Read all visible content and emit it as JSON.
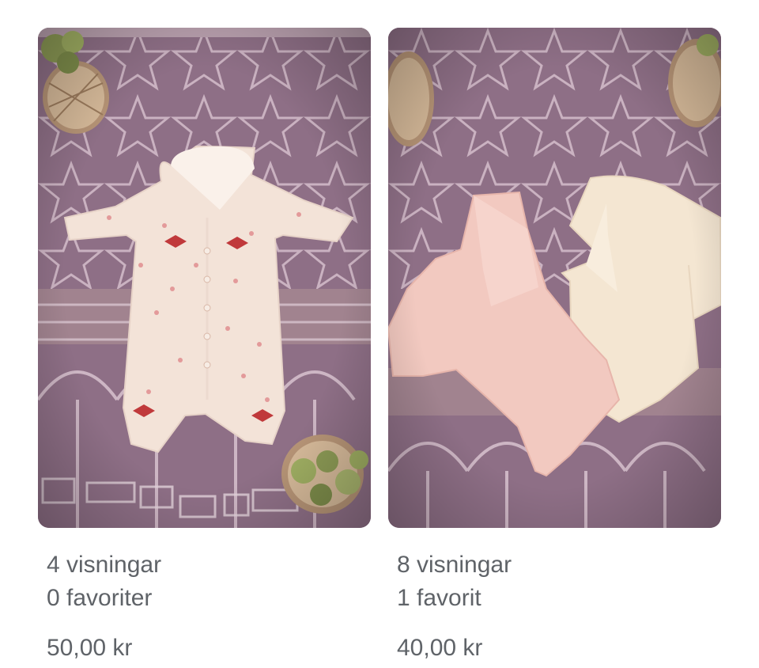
{
  "listings": [
    {
      "views": "4 visningar",
      "favorites": "0 favoriter",
      "price": "50,00 kr",
      "image_icon": "baby-romper-photo",
      "colors": {
        "rug": "#8e6f86",
        "pattern": "#d9c3cf",
        "garment": "#f3e3d8",
        "accent": "#c0393b"
      }
    },
    {
      "views": "8 visningar",
      "favorites": "1 favorit",
      "price": "40,00 kr",
      "image_icon": "baby-bodysuits-photo",
      "colors": {
        "rug": "#8e6f86",
        "pattern": "#d9c3cf",
        "garment_pink": "#f2c9c0",
        "garment_cream": "#f4e6d2"
      }
    }
  ]
}
